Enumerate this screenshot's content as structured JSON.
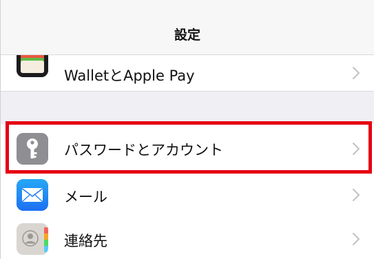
{
  "navbar": {
    "title": "設定"
  },
  "rows": {
    "wallet": {
      "label": "WalletとApple Pay",
      "icon": "wallet-icon"
    },
    "passwords": {
      "label": "パスワードとアカウント",
      "icon": "key-icon"
    },
    "mail": {
      "label": "メール",
      "icon": "mail-icon"
    },
    "contacts": {
      "label": "連絡先",
      "icon": "contacts-icon"
    }
  },
  "highlight_color": "#e50012"
}
